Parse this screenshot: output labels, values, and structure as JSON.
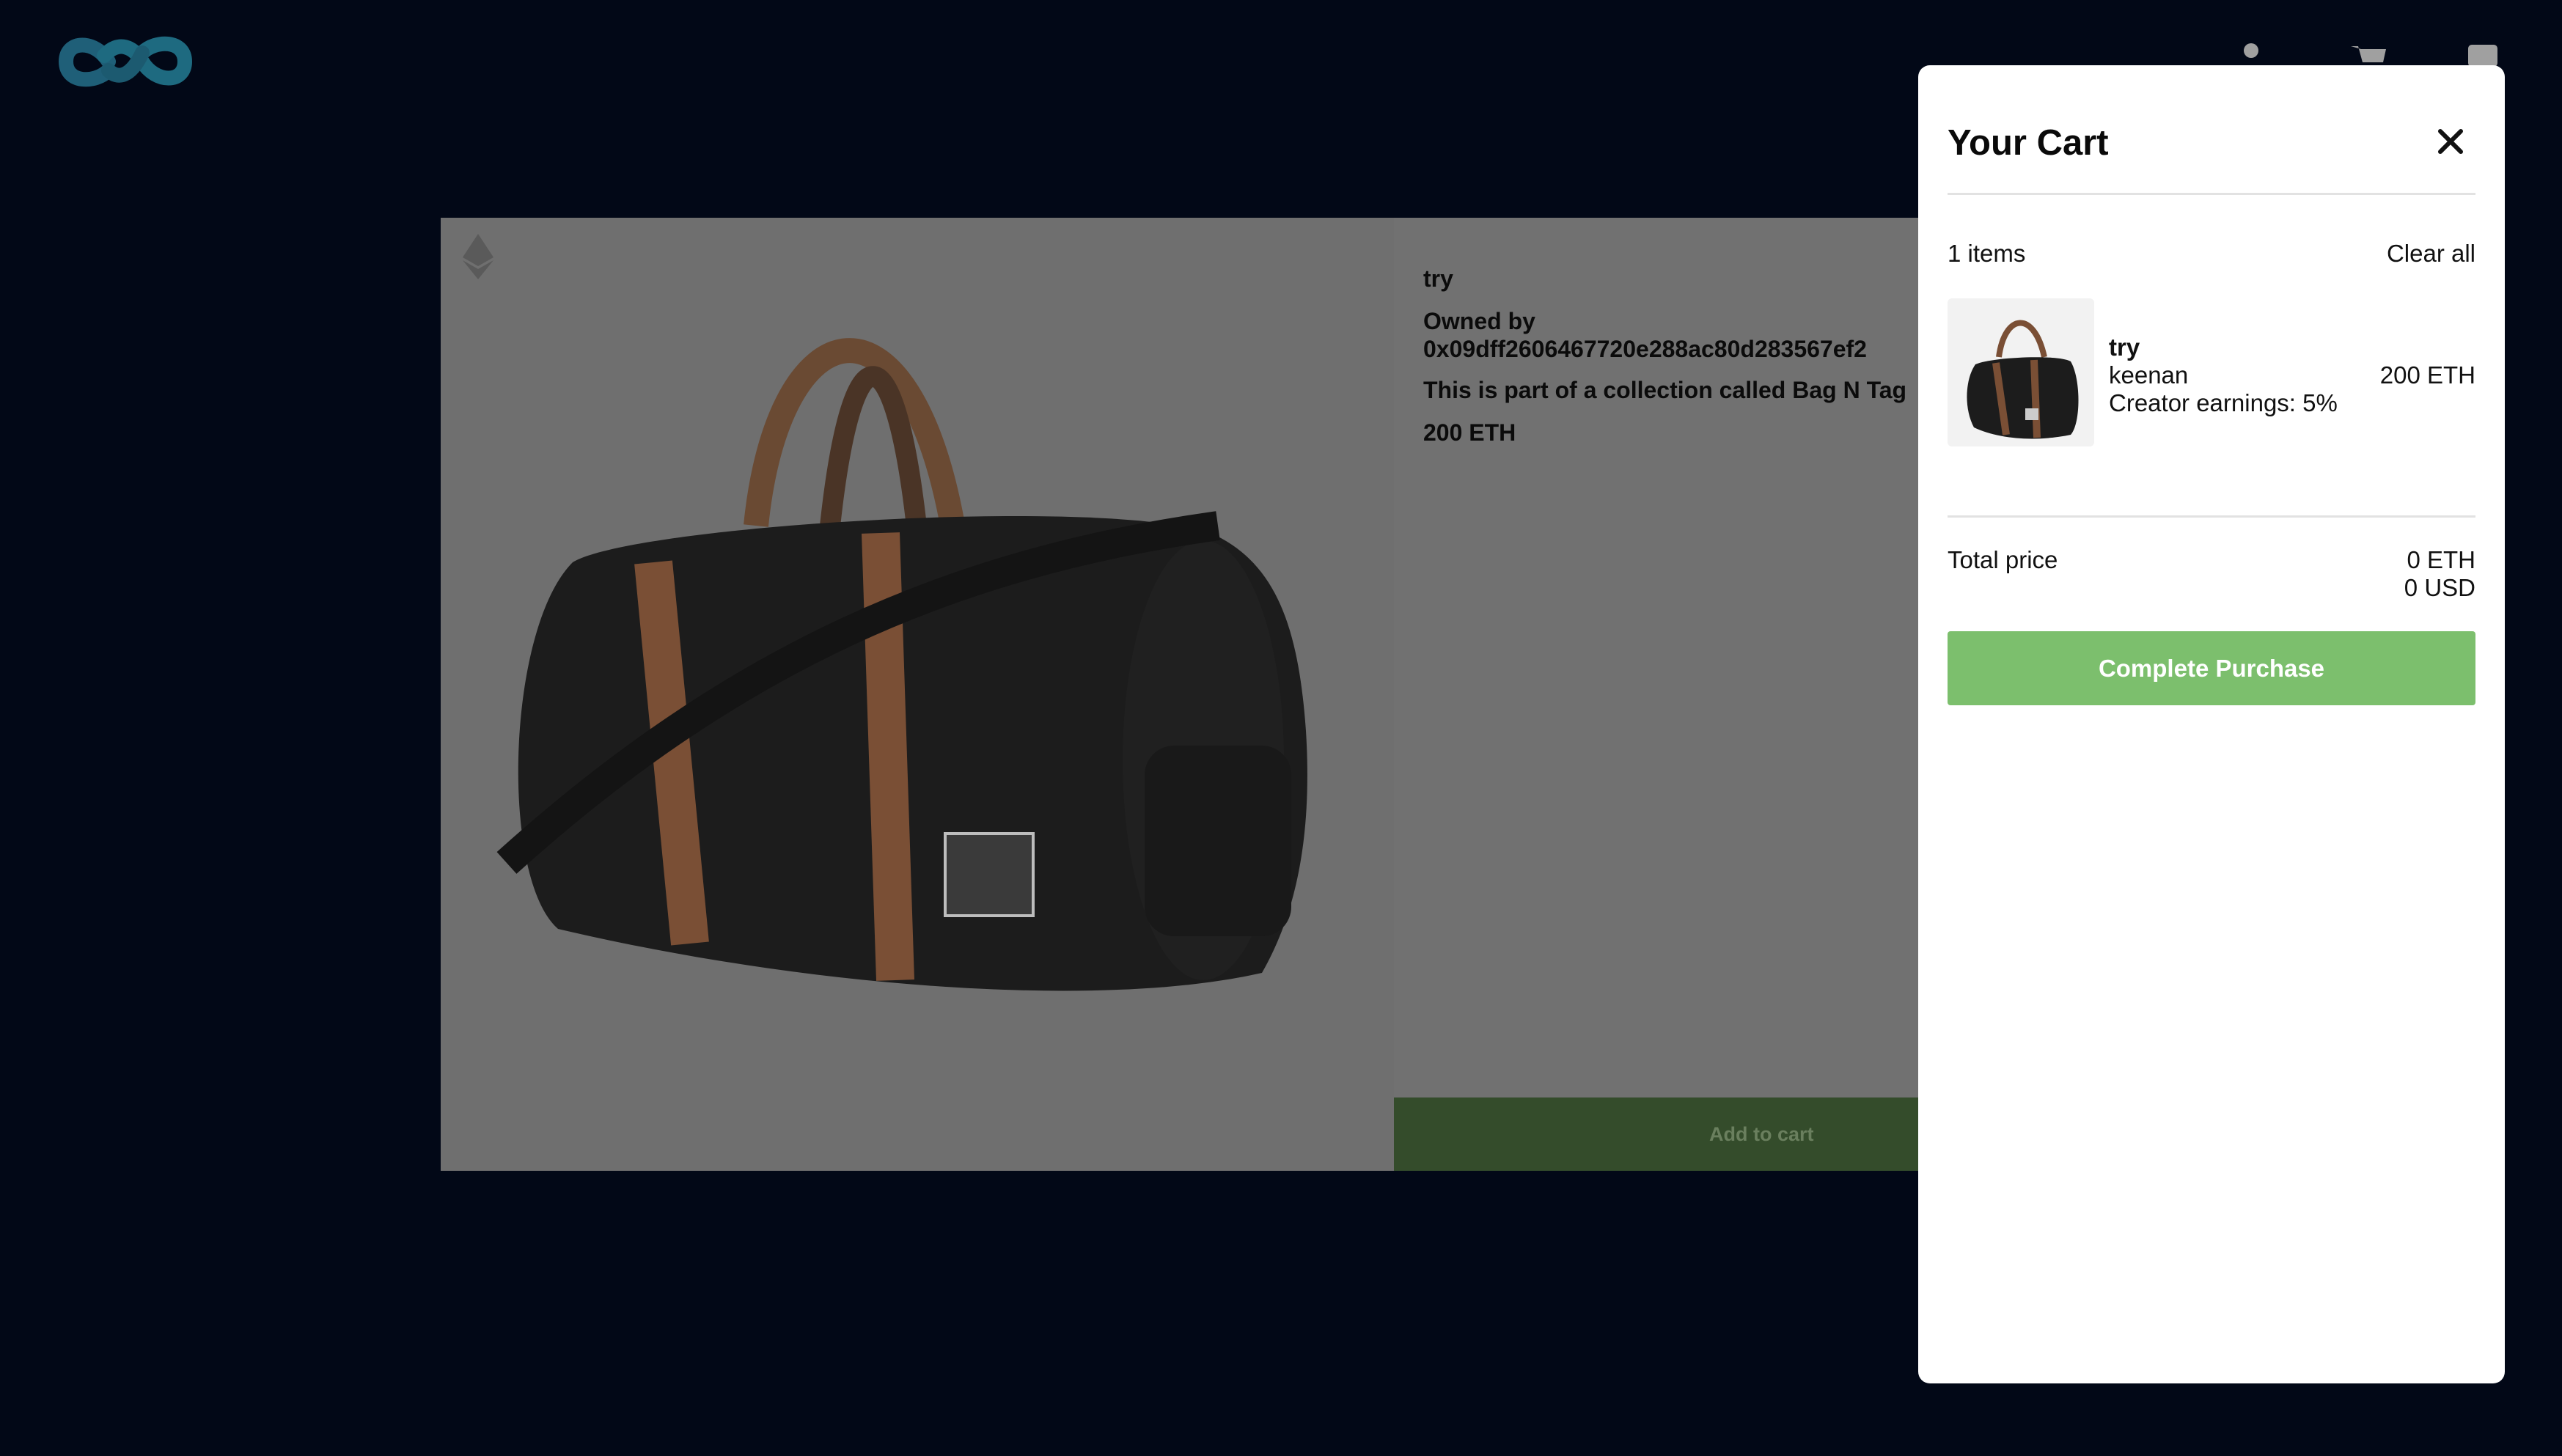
{
  "header": {
    "logo_icon": "infinity-logo-icon",
    "icons": [
      "user-icon",
      "cart-icon",
      "wallet-icon"
    ]
  },
  "product": {
    "title": "try",
    "owner_label": "Owned by",
    "owner_address": "0x09dff2606467720e288ac80d283567ef2",
    "collection_text": "This is part of a collection called Bag N Tag",
    "price": "200 ETH",
    "add_to_cart_label": "Add to cart",
    "chain_icon": "ethereum-icon"
  },
  "cart": {
    "title": "Your Cart",
    "items_count": "1 items",
    "clear_all_label": "Clear all",
    "items": [
      {
        "name": "try",
        "creator": "keenan",
        "earnings": "Creator earnings: 5%",
        "price": "200 ETH"
      }
    ],
    "total_label": "Total price",
    "total_eth": "0 ETH",
    "total_usd": "0 USD",
    "purchase_label": "Complete Purchase"
  },
  "colors": {
    "background": "#020817",
    "accent_green": "#7cbf6d",
    "logo_teal": "#1f5f78"
  }
}
